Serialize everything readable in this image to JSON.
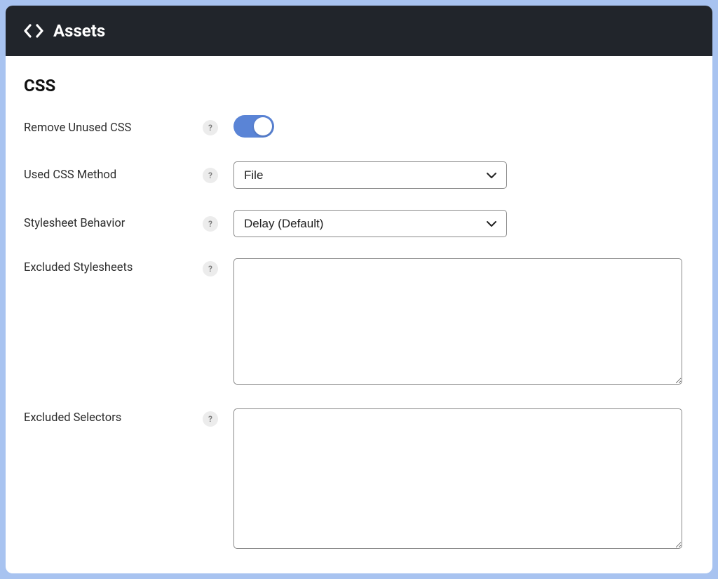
{
  "header": {
    "title": "Assets",
    "icon": "code-icon"
  },
  "section": {
    "title": "CSS"
  },
  "fields": {
    "removeUnusedCss": {
      "label": "Remove Unused CSS",
      "help": "?",
      "value": true
    },
    "usedCssMethod": {
      "label": "Used CSS Method",
      "help": "?",
      "value": "File"
    },
    "stylesheetBehavior": {
      "label": "Stylesheet Behavior",
      "help": "?",
      "value": "Delay (Default)"
    },
    "excludedStylesheets": {
      "label": "Excluded Stylesheets",
      "help": "?",
      "value": ""
    },
    "excludedSelectors": {
      "label": "Excluded Selectors",
      "help": "?",
      "value": ""
    }
  }
}
